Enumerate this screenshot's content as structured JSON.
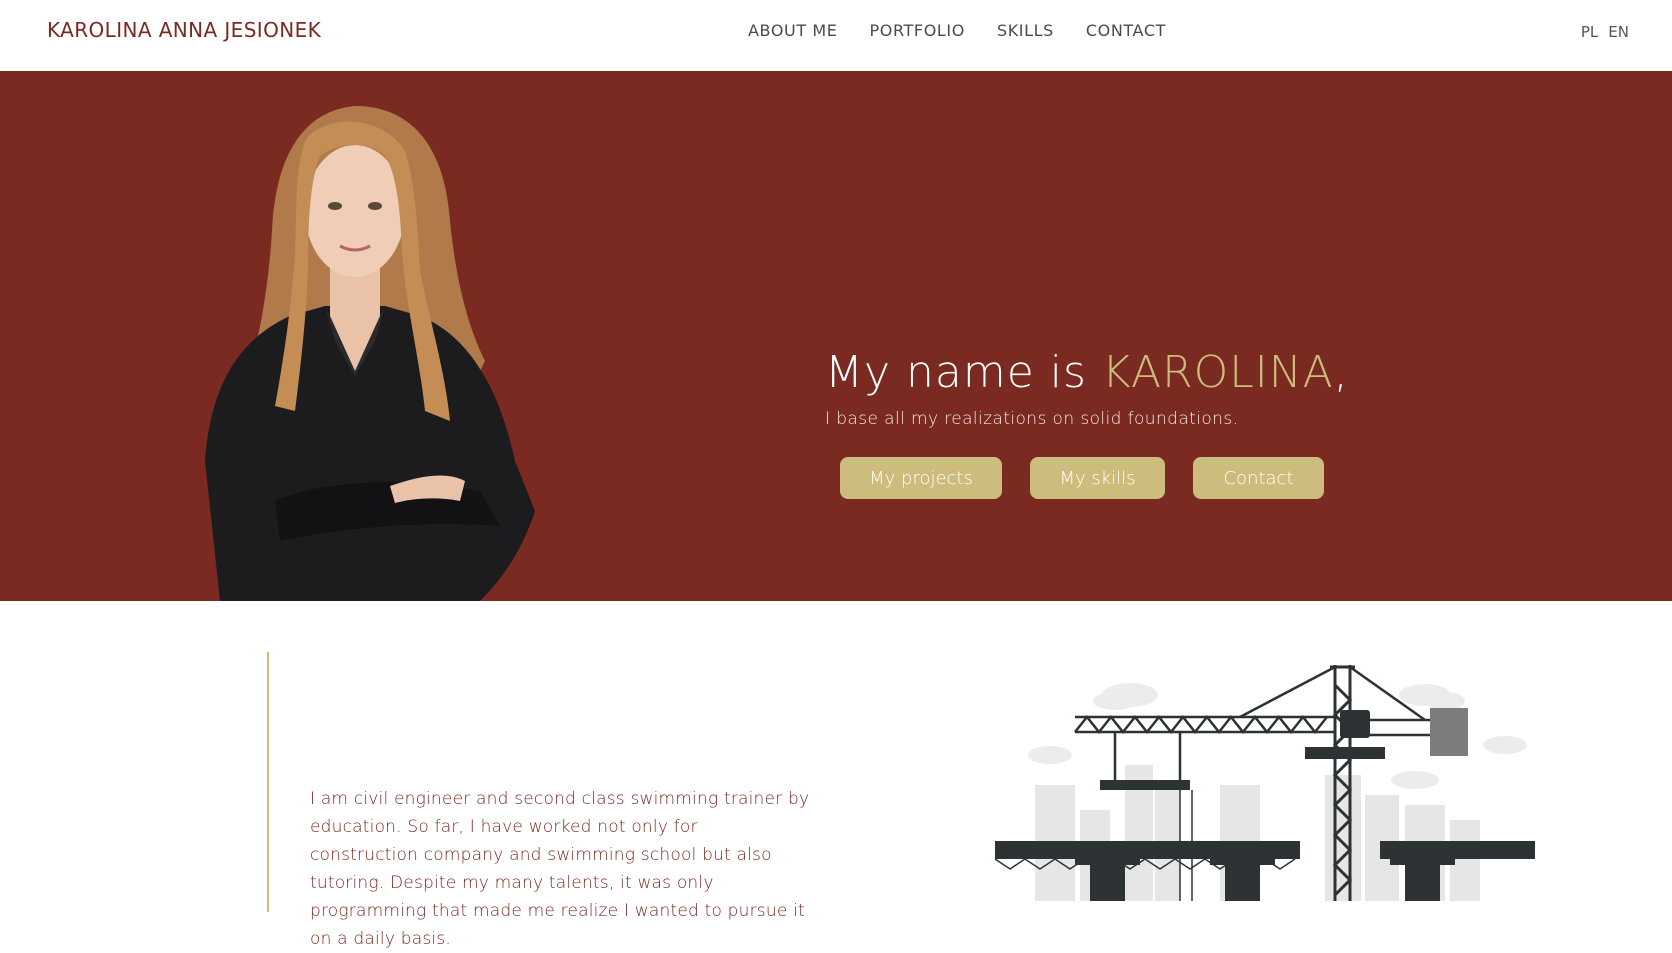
{
  "header": {
    "brand": "KAROLINA ANNA JESIONEK",
    "nav": [
      "ABOUT ME",
      "PORTFOLIO",
      "SKILLS",
      "CONTACT"
    ],
    "languages": [
      "PL",
      "EN"
    ]
  },
  "hero": {
    "title_prefix": "My name is ",
    "title_name": "KAROLINA",
    "title_suffix": ",",
    "subtitle": "I base all my realizations on solid foundations.",
    "buttons": [
      "My projects",
      "My skills",
      "Contact"
    ]
  },
  "about": {
    "text": "I am civil engineer and second class swimming trainer by education. So far, I have worked not only for construction company and swimming school but also tutoring. Despite my many talents, it was only programming that made me realize I wanted to pursue it on a daily basis."
  },
  "colors": {
    "hero_bg": "#7a2a21",
    "accent_gold": "#cdbd7c",
    "brand_text": "#7a2a22"
  },
  "icons": [
    "portrait-photo",
    "construction-crane-illustration"
  ]
}
